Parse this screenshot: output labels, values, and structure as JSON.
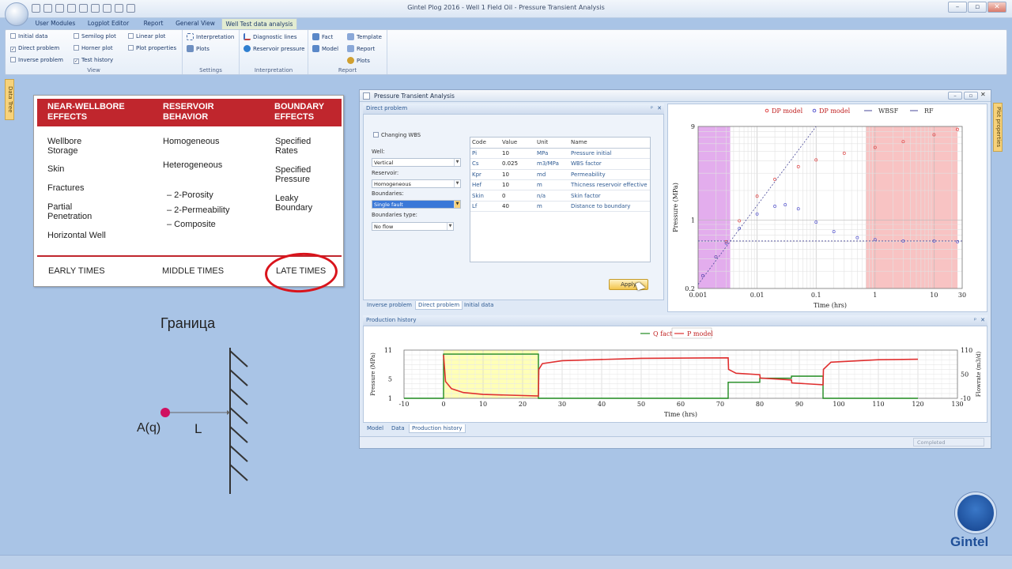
{
  "window": {
    "title": "Gintel Plog 2016  -  Well 1 Field Oil - Pressure Transient Analysis"
  },
  "tabs": [
    "User Modules",
    "Logplot Editor",
    "Report",
    "General View",
    "Well Test data analysis"
  ],
  "ribbon": {
    "view": {
      "label": "View",
      "items": [
        "Initial data",
        "Direct problem",
        "Inverse problem",
        "Semilog plot",
        "Horner plot",
        "Test history",
        "Linear plot",
        "Plot properties"
      ]
    },
    "settings": {
      "label": "Settings",
      "items": [
        "Interpretation",
        "Plots"
      ]
    },
    "interpretation": {
      "label": "Interpretation",
      "items": [
        "Diagnostic lines",
        "Reservoir pressure"
      ]
    },
    "report": {
      "label": "Report",
      "items": [
        "Fact",
        "Model",
        "Template",
        "Report",
        "Plots"
      ]
    }
  },
  "side_tabs": {
    "left": "Data Tree",
    "right": "Plot properties"
  },
  "slide": {
    "headers": [
      "NEAR-WELLBORE EFFECTS",
      "RESERVOIR BEHAVIOR",
      "BOUNDARY EFFECTS"
    ],
    "col1": [
      "Wellbore Storage",
      "Skin",
      "Fractures",
      "Partial Penetration",
      "Horizontal Well"
    ],
    "col2": [
      "Homogeneous",
      "Heterogeneous",
      "– 2-Porosity",
      "– 2-Permeability",
      "– Composite"
    ],
    "col3": [
      "Specified Rates",
      "Specified Pressure",
      "Leaky Boundary"
    ],
    "times": [
      "EARLY TIMES",
      "MIDDLE TIMES",
      "LATE TIMES"
    ]
  },
  "sketch": {
    "title": "Граница",
    "point_label": "A(q)",
    "distance_label": "L"
  },
  "pta": {
    "title": "Pressure Transient Analysis",
    "direct_problem": {
      "header": "Direct problem",
      "changing_wbs": "Changing WBS",
      "well_label": "Well:",
      "well_value": "Vertical",
      "reservoir_label": "Reservoir:",
      "reservoir_value": "Homogeneous",
      "boundaries_label": "Boundaries:",
      "boundaries_value": "Single fault",
      "boundaries_type_label": "Boundaries type:",
      "boundaries_type_value": "No flow",
      "columns": [
        "Code",
        "Value",
        "Unit",
        "Name"
      ],
      "rows": [
        [
          "Pi",
          "10",
          "MPa",
          "Pressure initial"
        ],
        [
          "Cs",
          "0.025",
          "m3/MPa",
          "WBS factor"
        ],
        [
          "Kpr",
          "10",
          "md",
          "Permeability"
        ],
        [
          "Hef",
          "10",
          "m",
          "Thicness reservoir effective"
        ],
        [
          "Skin",
          "0",
          "n/a",
          "Skin factor"
        ],
        [
          "Lf",
          "40",
          "m",
          "Distance to boundary"
        ]
      ],
      "apply": "Apply",
      "bottom_tabs": [
        "Inverse problem",
        "Direct problem",
        "Initial data"
      ]
    },
    "production": {
      "header": "Production history",
      "bottom_tabs": [
        "Model",
        "Data",
        "Production history"
      ],
      "status": "Completed"
    }
  },
  "chart_data": [
    {
      "type": "scatter",
      "title": "",
      "xlabel": "Time (hrs)",
      "ylabel": "Pressure (MPa)",
      "xscale": "log",
      "yscale": "log",
      "xlim": [
        0.001,
        30
      ],
      "ylim": [
        0.2,
        9
      ],
      "xticks": [
        "0.001",
        "0.01",
        "0.1",
        "1",
        "10",
        "30"
      ],
      "yticks": [
        "0.2",
        "1",
        "9"
      ],
      "legend": [
        "DP model",
        "DP model",
        "WBSF",
        "RF"
      ],
      "legend_position": "top",
      "series": [
        {
          "name": "DP model",
          "color": "#e04848",
          "x": [
            0.0012,
            0.002,
            0.003,
            0.005,
            0.01,
            0.02,
            0.05,
            0.1,
            0.3,
            1,
            3,
            10,
            25
          ],
          "y": [
            0.27,
            0.42,
            0.6,
            0.98,
            1.75,
            2.6,
            3.5,
            4.1,
            4.8,
            5.5,
            6.3,
            7.4,
            8.4
          ]
        },
        {
          "name": "DP model",
          "color": "#5a5ad0",
          "x": [
            0.0012,
            0.002,
            0.003,
            0.005,
            0.01,
            0.02,
            0.03,
            0.05,
            0.1,
            0.2,
            0.5,
            1,
            3,
            10,
            25
          ],
          "y": [
            0.27,
            0.42,
            0.58,
            0.82,
            1.15,
            1.38,
            1.43,
            1.3,
            0.95,
            0.76,
            0.66,
            0.63,
            0.61,
            0.61,
            0.6
          ]
        },
        {
          "name": "WBSF",
          "color": "#4a4a9a",
          "x": [
            0.001,
            0.1
          ],
          "y": [
            0.22,
            12
          ]
        },
        {
          "name": "RF",
          "color": "#4a4a9a",
          "x": [
            0.001,
            30
          ],
          "y": [
            0.61,
            0.61
          ]
        }
      ],
      "shaded_regions": [
        {
          "x": [
            0.001,
            0.0035
          ],
          "color": "#c04ad8"
        },
        {
          "x": [
            0.7,
            25
          ],
          "color": "#f07a7a"
        }
      ],
      "grid": true
    },
    {
      "type": "line",
      "title": "",
      "xlabel": "Time (hrs)",
      "ylabel": "Pressure (MPa)",
      "y2label": "Flowrate (m3/d)",
      "xlim": [
        -10,
        130
      ],
      "ylim": [
        1,
        11
      ],
      "y2lim": [
        -10,
        110
      ],
      "xticks": [
        "-10",
        "0",
        "10",
        "20",
        "30",
        "40",
        "50",
        "60",
        "70",
        "80",
        "90",
        "100",
        "110",
        "120",
        "130"
      ],
      "yticks": [
        "1",
        "5",
        "11"
      ],
      "y2ticks": [
        "-10",
        "50",
        "110"
      ],
      "legend": [
        "Q fact",
        "P model"
      ],
      "legend_position": "top-right",
      "series": [
        {
          "name": "Q fact",
          "color": "#1f8a1f",
          "axis": "right",
          "x": [
            -10,
            0,
            0,
            24,
            24,
            72,
            72,
            80,
            80,
            88,
            88,
            96,
            96,
            120
          ],
          "y": [
            -10,
            -10,
            100,
            100,
            -10,
            -10,
            30,
            30,
            40,
            40,
            45,
            45,
            -10,
            -10
          ]
        },
        {
          "name": "P model",
          "color": "#e03030",
          "axis": "left",
          "x": [
            0,
            0.5,
            2,
            5,
            10,
            24,
            24.1,
            25,
            30,
            50,
            72,
            72.1,
            74,
            80,
            80.1,
            88,
            88.1,
            96,
            96.1,
            98,
            110,
            120
          ],
          "y": [
            10,
            4.5,
            3.0,
            2.2,
            1.8,
            1.5,
            7.0,
            8.2,
            8.8,
            9.3,
            9.4,
            7.0,
            6.2,
            5.9,
            5.2,
            4.8,
            4.2,
            3.8,
            7.0,
            8.5,
            9.0,
            9.1
          ]
        }
      ],
      "shaded_regions": [
        {
          "x": [
            0,
            24
          ],
          "color": "#ffff99"
        }
      ],
      "grid": true
    }
  ],
  "colors": {
    "slide_header": "#c0262d",
    "circle": "#d9141c",
    "accent": "#2f5b93",
    "ribbon_tab_active": "#e2ecd2"
  }
}
